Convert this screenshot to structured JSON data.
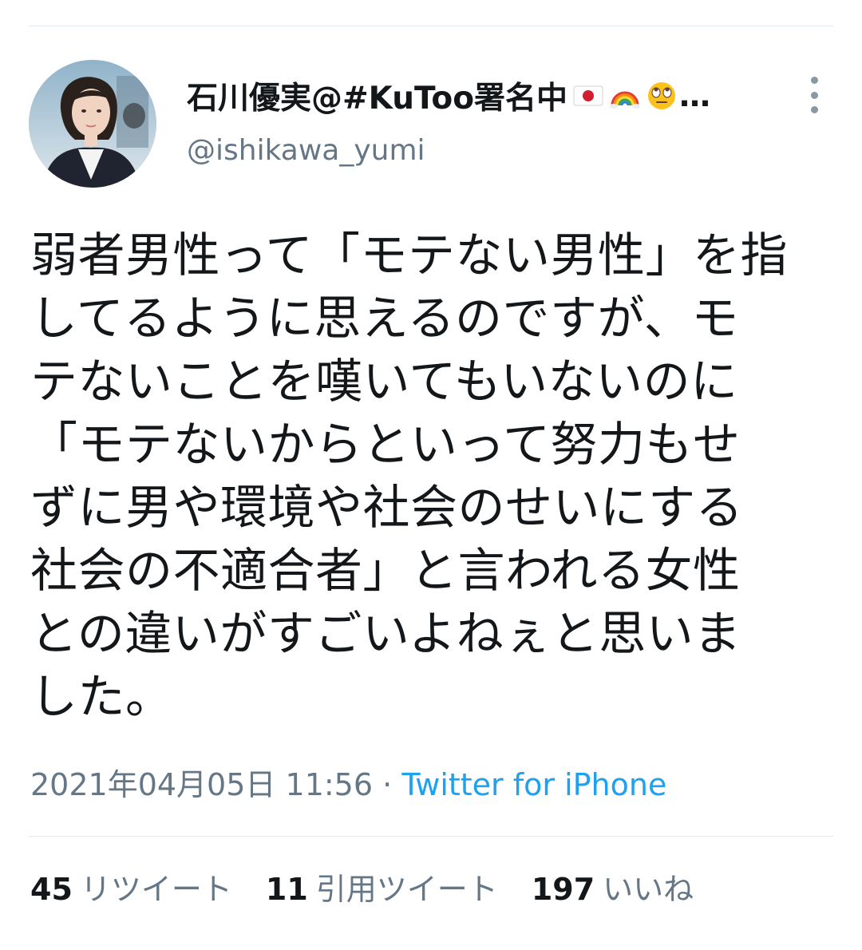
{
  "author": {
    "display_name": "石川優実@#KuToo署名中",
    "name_emojis": [
      "flag-japan-icon",
      "rainbow-icon",
      "face-rolling-eyes-icon"
    ],
    "truncation": "…",
    "handle": "@ishikawa_yumi"
  },
  "tweet": {
    "text": "弱者男性って「モテない男性」を指\nしてるように思えるのですが、モ\nテないことを嘆いてもいないのに\n「モテないからといって努力もせ\nずに男や環境や社会のせいにする\n社会の不適合者」と言われる女性\nとの違いがすごいよねぇと思いま\nした。",
    "date": "2021年04月05日",
    "time": "11:56",
    "separator": "·",
    "source": "Twitter for iPhone"
  },
  "stats": {
    "retweets": {
      "count": "45",
      "label": "リツイート"
    },
    "quotes": {
      "count": "11",
      "label": "引用ツイート"
    },
    "likes": {
      "count": "197",
      "label": "いいね"
    }
  },
  "colors": {
    "link": "#1da1f2",
    "secondary_text": "#657786",
    "primary_text": "#14171a",
    "divider": "#e1e8ed"
  }
}
